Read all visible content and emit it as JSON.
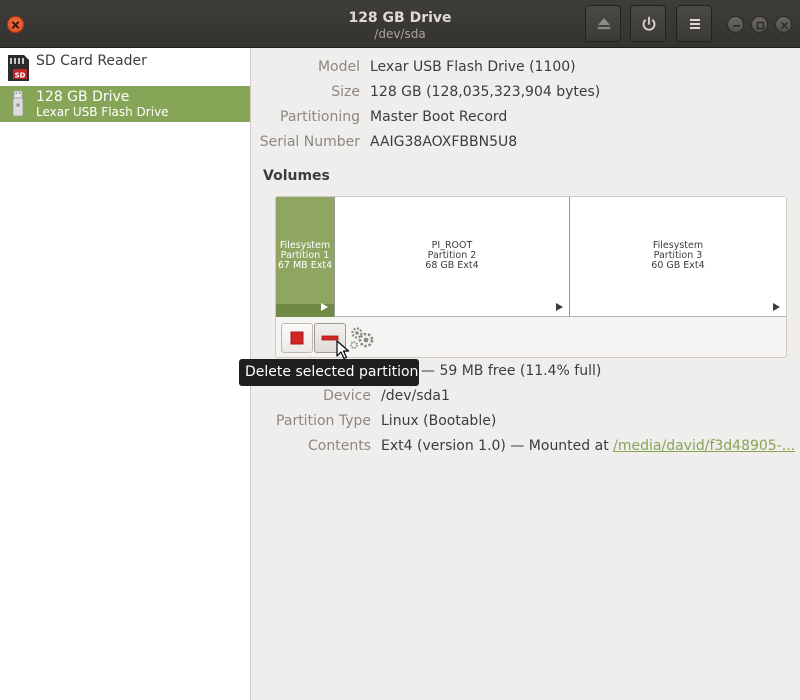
{
  "window": {
    "title": "128 GB Drive",
    "subtitle": "/dev/sda"
  },
  "header_icons": {
    "close": "close-icon",
    "eject": "eject-icon",
    "power": "power-icon",
    "menu": "hamburger-menu-icon",
    "minimize": "minimize-icon",
    "maximize": "maximize-icon",
    "window_close": "window-close-icon"
  },
  "sidebar": {
    "items": [
      {
        "name": "SD Card Reader",
        "sub": "",
        "icon": "sd-card-icon"
      },
      {
        "name": "128 GB Drive",
        "sub": "Lexar USB Flash Drive",
        "icon": "usb-drive-icon"
      }
    ]
  },
  "drive": {
    "model_label": "Model",
    "model": "Lexar USB Flash Drive (1100)",
    "size_label": "Size",
    "size": "128 GB (128,035,323,904 bytes)",
    "partitioning_label": "Partitioning",
    "partitioning": "Master Boot Record",
    "serial_label": "Serial Number",
    "serial": "AAIG38AOXFBBN5U8"
  },
  "volumes": {
    "heading": "Volumes",
    "partitions": [
      {
        "line1": "Filesystem",
        "line2": "Partition 1",
        "line3": "67 MB Ext4",
        "selected": true
      },
      {
        "line1": "PI_ROOT",
        "line2": "Partition 2",
        "line3": "68 GB Ext4",
        "selected": false
      },
      {
        "line1": "Filesystem",
        "line2": "Partition 3",
        "line3": "60 GB Ext4",
        "selected": false
      }
    ],
    "toolbar_icons": [
      "stop-icon",
      "minus-icon",
      "gears-icon"
    ]
  },
  "tooltip": "Delete selected partition",
  "partition": {
    "size_value_visible": "— 59 MB free (11.4% full)",
    "device_label": "Device",
    "device": "/dev/sda1",
    "type_label": "Partition Type",
    "type": "Linux (Bootable)",
    "contents_label": "Contents",
    "contents_prefix": "Ext4 (version 1.0) — Mounted at ",
    "contents_link": "/media/david/f3d48905-..."
  },
  "colors": {
    "accent": "#87a556",
    "header": "#3c3b37",
    "close": "#e95420",
    "delete_red": "#d22525"
  }
}
